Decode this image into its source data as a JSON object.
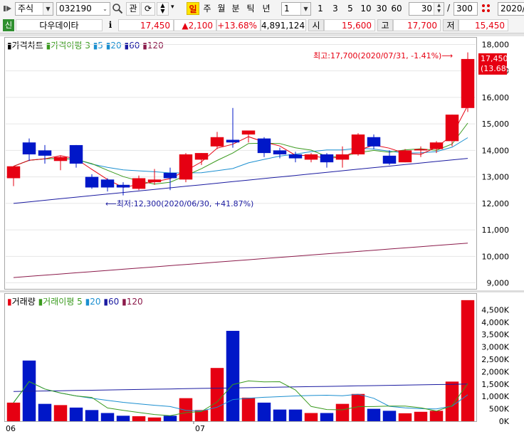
{
  "toolbar": {
    "market": "주식",
    "code": "032190",
    "fav_label": "관",
    "period_tabs": [
      "일",
      "주",
      "월",
      "분",
      "틱",
      "년"
    ],
    "active_tab": "일",
    "interval_value": "1",
    "quick_intervals": [
      "1",
      "3",
      "5",
      "10",
      "30",
      "60"
    ],
    "count_value": "30",
    "count_sep": "/",
    "count_total": "300",
    "date_value": "2020/"
  },
  "info": {
    "badge": "신",
    "name": "다우데이타",
    "info_btn": "i",
    "price": "17,450",
    "change": "▲2,100",
    "change_pct": "+13.68%",
    "volume": "4,891,124",
    "open_label": "시",
    "open": "15,600",
    "high_label": "고",
    "high": "17,700",
    "low_label": "저",
    "low": "15,450"
  },
  "price_chart": {
    "legend": [
      "가격차트",
      "가격이평",
      "3",
      "5",
      "20",
      "60",
      "120"
    ],
    "yticks": [
      "18,000",
      "17,000",
      "16,000",
      "15,000",
      "14,000",
      "13,000",
      "12,000",
      "11,000",
      "10,000",
      "9,000"
    ],
    "last_price": "17,450",
    "last_pct": "(13.68%)",
    "high_note": "최고:17,700(2020/07/31, -1.41%)⟶",
    "low_note": "⟵최저:12,300(2020/06/30, +41.87%)"
  },
  "volume_chart": {
    "legend": [
      "거래량",
      "거래이평",
      "5",
      "20",
      "60",
      "120"
    ],
    "yticks": [
      "4,500K",
      "4,000K",
      "3,500K",
      "3,000K",
      "2,500K",
      "2,000K",
      "1,500K",
      "1,000K",
      "500K",
      "0K"
    ]
  },
  "xaxis": {
    "labels": [
      "06",
      "07"
    ]
  },
  "colors": {
    "up": "#e60012",
    "down": "#0017c8",
    "ma3": "#e60012",
    "ma5": "#3a9a1e",
    "ma20": "#1b8fd0",
    "ma60": "#1a1aa0",
    "ma120": "#8b1a4a"
  },
  "chart_data": {
    "type": "candlestick",
    "y_range": [
      8800,
      18200
    ],
    "vol_range": [
      0,
      4800
    ],
    "x": [
      "06/15",
      "06/16",
      "06/17",
      "06/18",
      "06/19",
      "06/22",
      "06/23",
      "06/24",
      "06/25",
      "06/26",
      "06/29",
      "06/30",
      "07/01",
      "07/02",
      "07/03",
      "07/06",
      "07/07",
      "07/08",
      "07/09",
      "07/10",
      "07/13",
      "07/14",
      "07/15",
      "07/16",
      "07/17",
      "07/20",
      "07/21",
      "07/22",
      "07/23",
      "07/24",
      "07/27",
      "07/28",
      "07/29",
      "07/30",
      "07/31"
    ],
    "candles": [
      {
        "o": 12950,
        "h": 13400,
        "l": 12650,
        "c": 13400,
        "v": 750
      },
      {
        "o": 14300,
        "h": 14450,
        "l": 13600,
        "c": 13850,
        "v": 2450
      },
      {
        "o": 14000,
        "h": 14200,
        "l": 13500,
        "c": 13800,
        "v": 700
      },
      {
        "o": 13600,
        "h": 13800,
        "l": 13250,
        "c": 13750,
        "v": 650
      },
      {
        "o": 14200,
        "h": 14200,
        "l": 13350,
        "c": 13500,
        "v": 550
      },
      {
        "o": 13000,
        "h": 13100,
        "l": 12550,
        "c": 12600,
        "v": 450
      },
      {
        "o": 12900,
        "h": 12950,
        "l": 12450,
        "c": 12600,
        "v": 330
      },
      {
        "o": 12700,
        "h": 12800,
        "l": 12300,
        "c": 12600,
        "v": 220
      },
      {
        "o": 12550,
        "h": 13050,
        "l": 12500,
        "c": 12950,
        "v": 200
      },
      {
        "o": 12800,
        "h": 13300,
        "l": 12700,
        "c": 12900,
        "v": 150
      },
      {
        "o": 13150,
        "h": 13350,
        "l": 12500,
        "c": 12950,
        "v": 220
      },
      {
        "o": 12900,
        "h": 13900,
        "l": 12800,
        "c": 13850,
        "v": 930
      },
      {
        "o": 13650,
        "h": 13900,
        "l": 13450,
        "c": 13900,
        "v": 450
      },
      {
        "o": 14150,
        "h": 14700,
        "l": 14050,
        "c": 14500,
        "v": 2150
      },
      {
        "o": 14400,
        "h": 15600,
        "l": 14100,
        "c": 14300,
        "v": 3650
      },
      {
        "o": 14600,
        "h": 14750,
        "l": 14300,
        "c": 14750,
        "v": 950
      },
      {
        "o": 14450,
        "h": 14500,
        "l": 13750,
        "c": 13900,
        "v": 750
      },
      {
        "o": 14000,
        "h": 14100,
        "l": 13700,
        "c": 13850,
        "v": 470
      },
      {
        "o": 13850,
        "h": 13950,
        "l": 13550,
        "c": 13700,
        "v": 470
      },
      {
        "o": 13650,
        "h": 13900,
        "l": 13550,
        "c": 13850,
        "v": 330
      },
      {
        "o": 13850,
        "h": 13900,
        "l": 13350,
        "c": 13550,
        "v": 330
      },
      {
        "o": 13650,
        "h": 14150,
        "l": 13350,
        "c": 13850,
        "v": 700
      },
      {
        "o": 13850,
        "h": 14650,
        "l": 13800,
        "c": 14600,
        "v": 1100
      },
      {
        "o": 14500,
        "h": 14600,
        "l": 14050,
        "c": 14150,
        "v": 500
      },
      {
        "o": 13800,
        "h": 14000,
        "l": 13450,
        "c": 13500,
        "v": 420
      },
      {
        "o": 13550,
        "h": 14050,
        "l": 13550,
        "c": 14000,
        "v": 320
      },
      {
        "o": 14000,
        "h": 14150,
        "l": 13750,
        "c": 14050,
        "v": 380
      },
      {
        "o": 14050,
        "h": 14350,
        "l": 13900,
        "c": 14300,
        "v": 420
      },
      {
        "o": 14350,
        "h": 15350,
        "l": 14150,
        "c": 15350,
        "v": 1600
      },
      {
        "o": 15600,
        "h": 17700,
        "l": 15450,
        "c": 17450,
        "v": 4890
      }
    ],
    "ma60": {
      "start": 12000,
      "end": 13700
    },
    "ma120": {
      "start": 9200,
      "end": 10500
    }
  }
}
